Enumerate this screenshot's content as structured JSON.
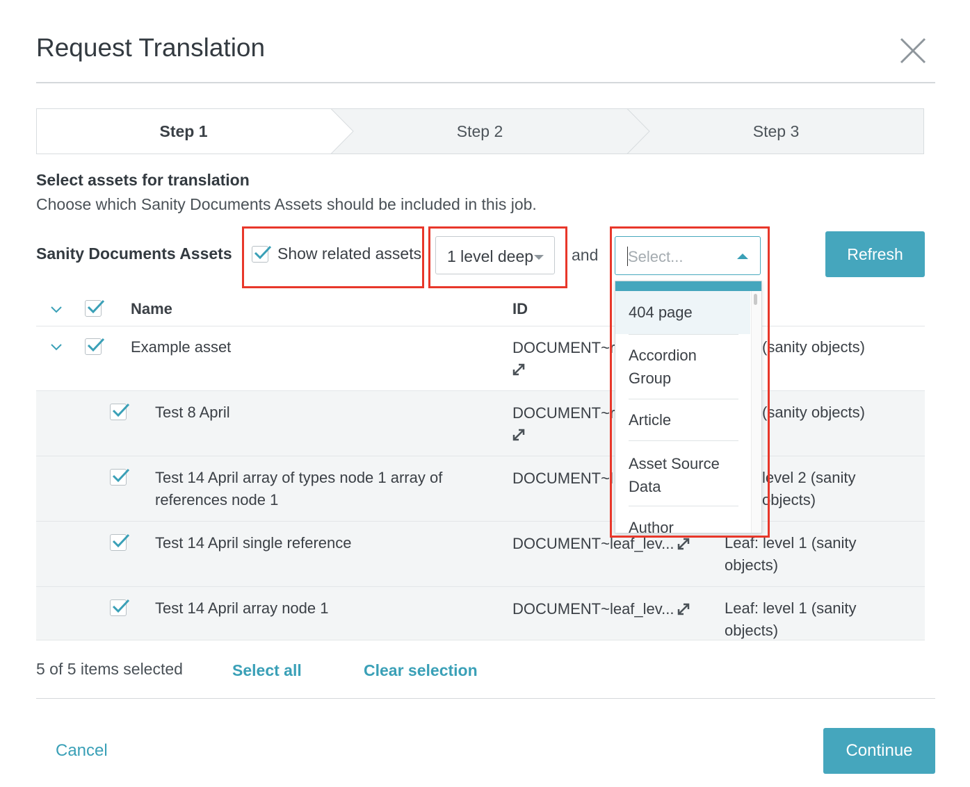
{
  "dialog": {
    "title": "Request Translation"
  },
  "steps": [
    {
      "label": "Step 1",
      "active": true
    },
    {
      "label": "Step 2",
      "active": false
    },
    {
      "label": "Step 3",
      "active": false
    }
  ],
  "section": {
    "title": "Select assets for translation",
    "description": "Choose which Sanity Documents Assets should be included in this job."
  },
  "toolbar": {
    "assets_label": "Sanity Documents Assets",
    "show_related_label": "Show related assets",
    "show_related_checked": true,
    "depth_value": "1 level deep",
    "and_label": "and",
    "type_placeholder": "Select...",
    "refresh_label": "Refresh"
  },
  "table": {
    "headers": {
      "name": "Name",
      "id": "ID"
    },
    "rows": [
      {
        "name": "Example asset",
        "id": "DOCUMENT~r",
        "type": "(sanity objects)",
        "checked": true,
        "parent": true
      },
      {
        "name": "Test 8 April",
        "id": "DOCUMENT~r",
        "type": "(sanity objects)",
        "checked": true
      },
      {
        "name": "Test 14 April array of types node 1 array of references node 1",
        "id": "DOCUMENT~l",
        "type": "level 2 (sanity objects)",
        "checked": true
      },
      {
        "name": "Test 14 April single reference",
        "id": "DOCUMENT~leaf_lev...",
        "type": "Leaf: level 1 (sanity objects)",
        "checked": true
      },
      {
        "name": "Test 14 April array node 1",
        "id": "DOCUMENT~leaf_lev...",
        "type": "Leaf: level 1 (sanity objects)",
        "checked": true
      }
    ]
  },
  "type_dropdown": {
    "options": [
      "404 page",
      "Accordion Group",
      "Article",
      "Asset Source Data",
      "Author"
    ],
    "highlighted": "404 page"
  },
  "footer": {
    "selected_count": "5 of 5 items selected",
    "select_all": "Select all",
    "clear_selection": "Clear selection",
    "cancel": "Cancel",
    "continue": "Continue"
  },
  "colors": {
    "accent": "#45a6bd",
    "link": "#3aa0b7",
    "annotation": "#e8372a"
  }
}
